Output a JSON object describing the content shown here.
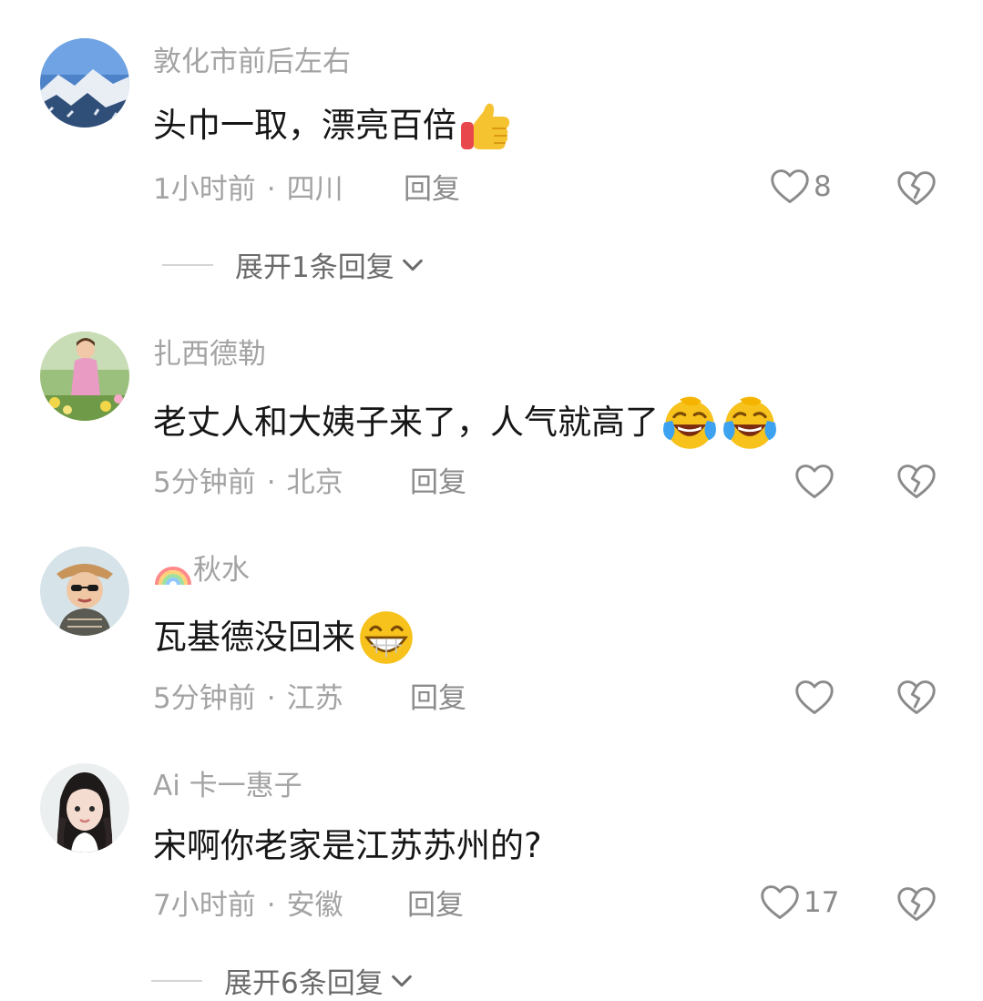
{
  "comments": [
    {
      "username": "敦化市前后左右",
      "text": "头巾一取，漂亮百倍",
      "emoji": [
        "thumbs-up-emoji"
      ],
      "time": "1小时前",
      "location": "四川",
      "reply_label": "回复",
      "likes": "8",
      "expand_label": "展开1条回复"
    },
    {
      "username": "扎西德勒",
      "text": "老丈人和大姨子来了，人气就高了",
      "emoji": [
        "crying-laughing-emoji",
        "crying-laughing-emoji"
      ],
      "time": "5分钟前",
      "location": "北京",
      "reply_label": "回复",
      "likes": ""
    },
    {
      "username": "秋水",
      "username_prefix_icon": "rainbow-icon",
      "text": "瓦基德没回来",
      "emoji": [
        "grinning-emoji"
      ],
      "time": "5分钟前",
      "location": "江苏",
      "reply_label": "回复",
      "likes": ""
    },
    {
      "username": "Ai 卡一惠子",
      "text": "宋啊你老家是江苏苏州的?",
      "emoji": [],
      "time": "7小时前",
      "location": "安徽",
      "reply_label": "回复",
      "likes": "17",
      "expand_label": "展开6条回复"
    }
  ],
  "separator": "·",
  "icons": {
    "like": "heart-outline-icon",
    "dislike": "broken-heart-icon",
    "expand": "chevron-down-icon"
  },
  "colors": {
    "username": "#a3a3a3",
    "text": "#161616",
    "meta": "#a3a3a3",
    "icon": "#8b8b8b"
  }
}
